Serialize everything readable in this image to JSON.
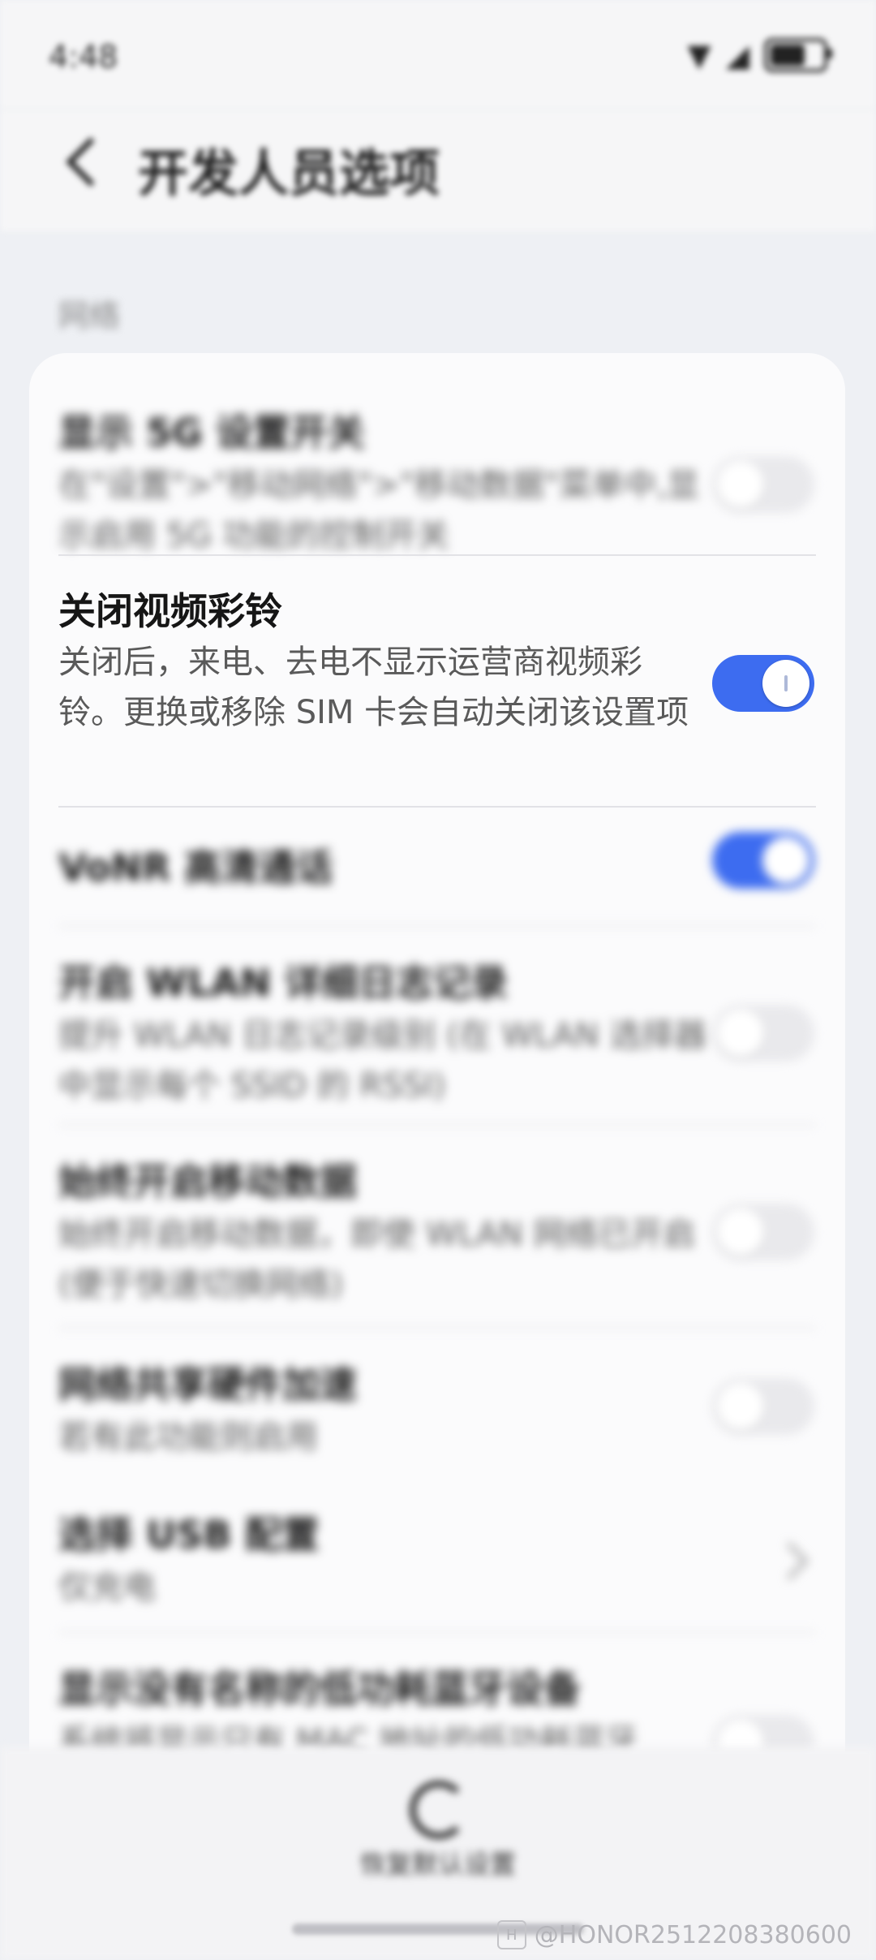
{
  "status_bar": {
    "time": "4:48",
    "icons": [
      "wifi-icon",
      "signal-icon",
      "battery-icon"
    ]
  },
  "header": {
    "title": "开发人员选项"
  },
  "section": {
    "label": "网络"
  },
  "items": [
    {
      "title": "显示 5G 设置开关",
      "desc": "在\"设置\">\"移动网络\">\"移动数据\"菜单中,显示启用 5G 功能的控制开关",
      "control": "toggle",
      "checked": false
    },
    {
      "title": "关闭视频彩铃",
      "desc": "关闭后，来电、去电不显示运营商视频彩铃。更换或移除 SIM 卡会自动关闭该设置项",
      "control": "toggle",
      "checked": true
    },
    {
      "title": "VoNR 高清通话",
      "desc": "",
      "control": "toggle",
      "checked": true
    },
    {
      "title": "开启 WLAN 详细日志记录",
      "desc": "提升 WLAN 日志记录级别 (在 WLAN 选择器中显示每个 SSID 的 RSSI)",
      "control": "toggle",
      "checked": false
    },
    {
      "title": "始终开启移动数据",
      "desc": "始终开启移动数据，即使 WLAN 网络已开启 (便于快速切换网络)",
      "control": "toggle",
      "checked": false
    },
    {
      "title": "网络共享硬件加速",
      "desc": "若有此功能则启用",
      "control": "toggle",
      "checked": false
    },
    {
      "title": "选择 USB 配置",
      "desc": "仅充电",
      "control": "chevron",
      "checked": false
    },
    {
      "title": "显示没有名称的低功耗蓝牙设备",
      "desc": "系统将显示只有 MAC 地址的低功耗蓝牙",
      "control": "toggle",
      "checked": false
    }
  ],
  "bottom": {
    "restore_label": "恢复默认设置"
  },
  "watermark": {
    "badge": "H",
    "text": "@HONOR2512208380600"
  },
  "colors": {
    "accent": "#3d6cf0",
    "toggle_off": "#e9e9ec",
    "background": "#eef0f4"
  }
}
